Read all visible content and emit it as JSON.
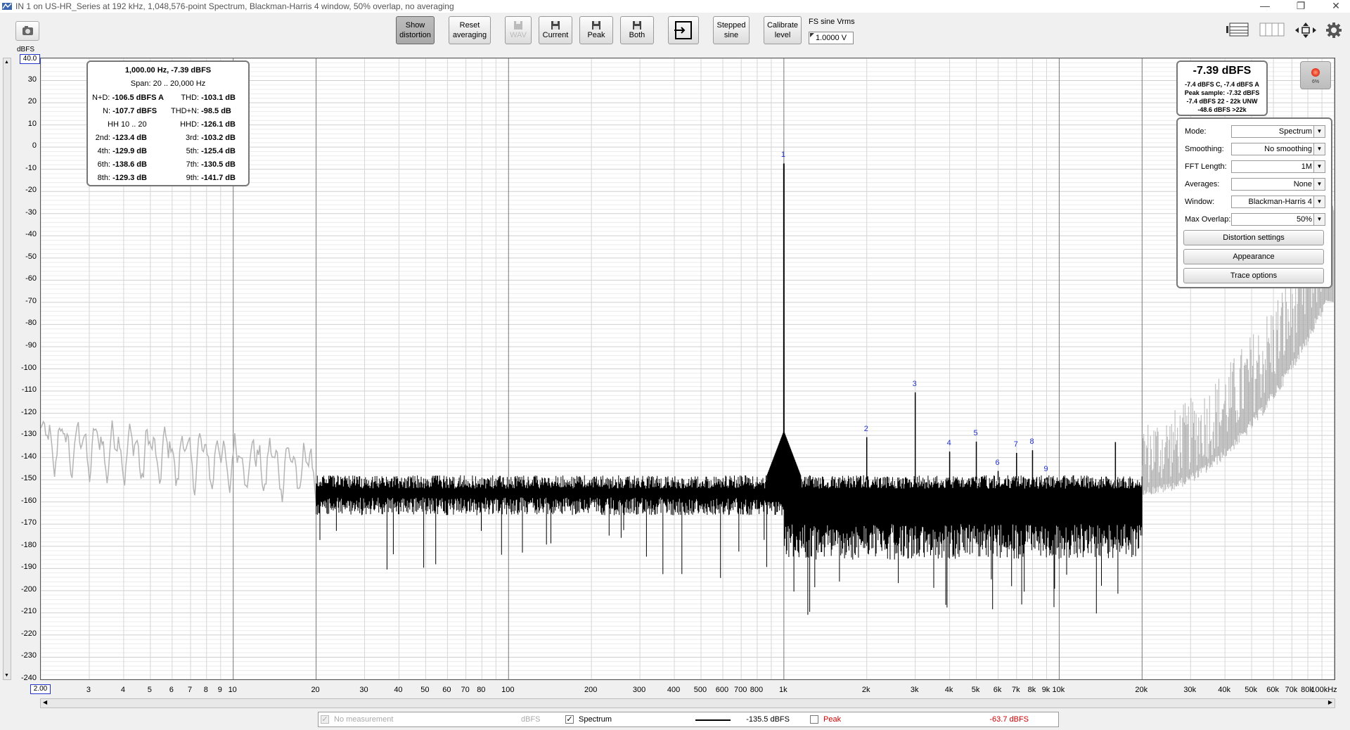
{
  "window": {
    "title": "IN 1 on US-HR_Series at 192 kHz, 1,048,576-point Spectrum, Blackman-Harris 4 window, 50% overlap, no averaging",
    "minimize": "—",
    "restore": "❐",
    "close": "✕"
  },
  "toolbar": {
    "show_distortion": [
      "Show",
      "distortion"
    ],
    "reset_averaging": [
      "Reset",
      "averaging"
    ],
    "wav": "WAV",
    "current": "Current",
    "peak": "Peak",
    "both": "Both",
    "stepped_sine": [
      "Stepped",
      "sine"
    ],
    "calibrate_level": [
      "Calibrate",
      "level"
    ],
    "fs_label": "FS sine Vrms",
    "fs_value": "1.0000 V"
  },
  "plot": {
    "y_unit": "dBFS",
    "y_top_value": "40.0",
    "x_left_value": "2.00",
    "y_ticks": [
      "30",
      "20",
      "10",
      "0",
      "-10",
      "-20",
      "-30",
      "-40",
      "-50",
      "-60",
      "-70",
      "-80",
      "-90",
      "-100",
      "-110",
      "-120",
      "-130",
      "-140",
      "-150",
      "-160",
      "-170",
      "-180",
      "-190",
      "-200",
      "-210",
      "-220",
      "-230",
      "-240"
    ],
    "x_ticks": [
      "3",
      "4",
      "5",
      "6",
      "7",
      "8",
      "9",
      "10",
      "20",
      "30",
      "40",
      "50",
      "60",
      "70",
      "80",
      "100",
      "200",
      "300",
      "400",
      "500",
      "600",
      "700",
      "800",
      "1k",
      "2k",
      "3k",
      "4k",
      "5k",
      "6k",
      "7k",
      "8k",
      "9k",
      "10k",
      "20k",
      "30k",
      "40k",
      "50k",
      "60k",
      "70k",
      "80k",
      "100kHz"
    ],
    "harmonic_markers": [
      "1",
      "2",
      "3",
      "4",
      "5",
      "6",
      "7",
      "8",
      "9"
    ]
  },
  "distortion_panel": {
    "header": "1,000.00 Hz, -7.39 dBFS",
    "span": "Span: 20 .. 20,000 Hz",
    "nd_label": "N+D:",
    "nd_value": "-106.5 dBFS A",
    "thd_label": "THD:",
    "thd_value": "-103.1 dB",
    "n_label": "N:",
    "n_value": "-107.7 dBFS",
    "thdn_label": "THD+N:",
    "thdn_value": "-98.5 dB",
    "hh_label": "HH 10 .. 20",
    "hhd_label": "HHD:",
    "hhd_value": "-126.1 dB",
    "h2_label": "2nd:",
    "h2_value": "-123.4 dB",
    "h3_label": "3rd:",
    "h3_value": "-103.2 dB",
    "h4_label": "4th:",
    "h4_value": "-129.9 dB",
    "h5_label": "5th:",
    "h5_value": "-125.4 dB",
    "h6_label": "6th:",
    "h6_value": "-138.6 dB",
    "h7_label": "7th:",
    "h7_value": "-130.5 dB",
    "h8_label": "8th:",
    "h8_value": "-129.3 dB",
    "h9_label": "9th:",
    "h9_value": "-141.7 dB"
  },
  "level_panel": {
    "main": "-7.39 dBFS",
    "line1": "-7.4 dBFS C, -7.4 dBFS A",
    "line2": "Peak sample: -7.32 dBFS",
    "line3": "-7.4 dBFS 22 - 22k UNW",
    "line4": "-48.6 dBFS >22k",
    "record_pct": "6%"
  },
  "controls": {
    "mode_label": "Mode:",
    "mode_value": "Spectrum",
    "smoothing_label": "Smoothing:",
    "smoothing_value": "No  smoothing",
    "fft_label": "FFT Length:",
    "fft_value": "1M",
    "averages_label": "Averages:",
    "averages_value": "None",
    "window_label": "Window:",
    "window_value": "Blackman-Harris 4",
    "overlap_label": "Max Overlap:",
    "overlap_value": "50%",
    "distortion_settings": "Distortion settings",
    "appearance": "Appearance",
    "trace_options": "Trace options"
  },
  "legend": {
    "no_measurement": "No measurement",
    "no_measurement_unit": "dBFS",
    "spectrum_label": "Spectrum",
    "spectrum_value": "-135.5 dBFS",
    "peak_label": "Peak",
    "peak_value": "-63.7 dBFS",
    "peak_color": "#cc0000"
  },
  "colors": {
    "trace": "#000000",
    "trace_outside": "#b4b4b4",
    "marker": "#2233cc",
    "record": "#e83a22"
  }
}
